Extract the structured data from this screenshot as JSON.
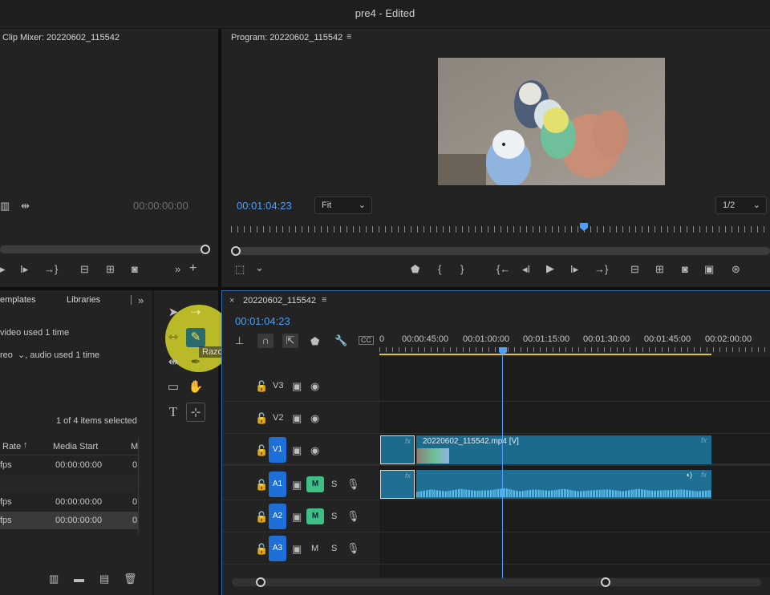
{
  "window": {
    "title": "pre4 - Edited"
  },
  "source_panel": {
    "title": "Clip Mixer: 20220602_115542",
    "timecode": "00:00:00:00"
  },
  "program_panel": {
    "title": "Program: 20220602_115542",
    "timecode": "00:01:04:23",
    "fit": "Fit",
    "resolution": "1/2"
  },
  "project_panel": {
    "tabs": [
      "emplates",
      "Libraries"
    ],
    "info_video": "video used 1 time",
    "info_audio": "reo  ⌄, audio used 1 time",
    "selected_count": "1 of 4 items selected",
    "columns": [
      "Rate",
      "Media Start",
      "M"
    ],
    "rows": [
      {
        "rate": "fps",
        "start": "00:00:00:00",
        "m": "0"
      },
      {
        "rate": "",
        "start": "",
        "m": ""
      },
      {
        "rate": "fps",
        "start": "00:00:00:00",
        "m": "0"
      },
      {
        "rate": "fps",
        "start": "00:00:00:00",
        "m": "0"
      }
    ]
  },
  "tools": {
    "tooltip": "Razor Tool (C)"
  },
  "timeline": {
    "sequence_name": "20220602_115542",
    "timecode": "00:01:04:23",
    "ruler_labels": [
      "0",
      "00:00:45:00",
      "00:01:00:00",
      "00:01:15:00",
      "00:01:30:00",
      "00:01:45:00",
      "00:02:00:00"
    ],
    "tracks": [
      {
        "id": "V3",
        "kind": "video"
      },
      {
        "id": "V2",
        "kind": "video"
      },
      {
        "id": "V1",
        "kind": "video"
      },
      {
        "id": "A1",
        "kind": "audio",
        "m": "M",
        "s": "S"
      },
      {
        "id": "A2",
        "kind": "audio",
        "m": "M",
        "s": "S"
      },
      {
        "id": "A3",
        "kind": "audio",
        "m": "M",
        "s": "S"
      }
    ],
    "clip_video_label": "20220602_115542.mp4 [V]",
    "fx": "fx",
    "playhead_fraction": 0.637
  },
  "colors": {
    "accent_blue": "#4e9ff5",
    "clip_video": "#1c6a8c",
    "clip_audio": "#1f6f94",
    "waveform": "#58c3f2",
    "track_label": "#1f6fd8",
    "mute_green": "#3fbf86",
    "highlight_yellow": "#e6e62a"
  }
}
